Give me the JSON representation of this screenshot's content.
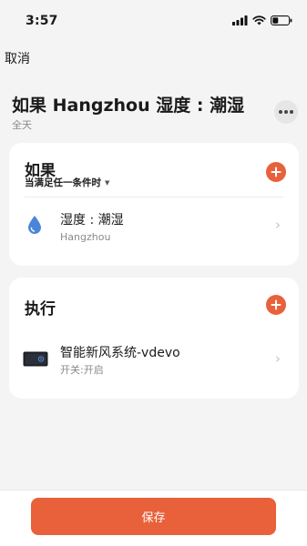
{
  "status_bar": {
    "time": "3:57"
  },
  "header": {
    "cancel_label": "取消",
    "title": "如果 Hangzhou 湿度 : 潮湿",
    "subtitle": "全天"
  },
  "if_section": {
    "title": "如果",
    "condition_mode": "当满足任一条件时",
    "items": [
      {
        "title": "湿度 : 潮湿",
        "subtitle": "Hangzhou",
        "icon": "water-drop-icon"
      }
    ]
  },
  "then_section": {
    "title": "执行",
    "items": [
      {
        "title": "智能新风系统-vdevo",
        "subtitle": "开关:开启",
        "icon": "air-purifier-device-icon"
      }
    ]
  },
  "footer": {
    "save_label": "保存"
  },
  "colors": {
    "accent": "#e8613a",
    "drop": "#4a86d8",
    "background": "#f4f4f4"
  }
}
